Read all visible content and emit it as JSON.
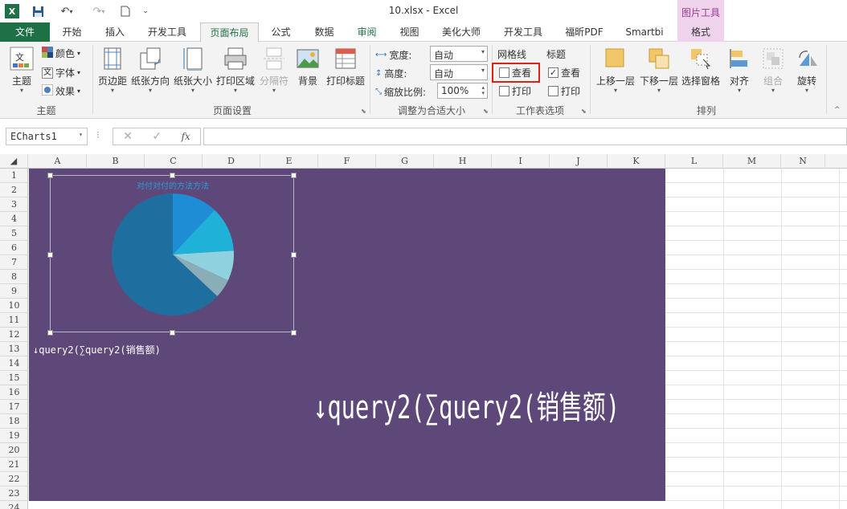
{
  "window": {
    "title": "10.xlsx - Excel",
    "context_group": "图片工具"
  },
  "tabs": [
    {
      "label": "文件"
    },
    {
      "label": "开始"
    },
    {
      "label": "插入"
    },
    {
      "label": "开发工具"
    },
    {
      "label": "页面布局"
    },
    {
      "label": "公式"
    },
    {
      "label": "数据"
    },
    {
      "label": "审阅"
    },
    {
      "label": "视图"
    },
    {
      "label": "美化大师"
    },
    {
      "label": "开发工具"
    },
    {
      "label": "福昕PDF"
    },
    {
      "label": "Smartbi"
    },
    {
      "label": "格式"
    }
  ],
  "ribbon": {
    "theme": {
      "themes": "主题",
      "colors": "颜色",
      "fonts": "字体",
      "effects": "效果",
      "group": "主题"
    },
    "page_setup": {
      "margins": "页边距",
      "orientation": "纸张方向",
      "size": "纸张大小",
      "print_area": "打印区域",
      "breaks": "分隔符",
      "background": "背景",
      "print_titles": "打印标题",
      "group": "页面设置"
    },
    "scale": {
      "width_label": "宽度:",
      "width_value": "自动",
      "height_label": "高度:",
      "height_value": "自动",
      "scale_label": "缩放比例:",
      "scale_value": "100%",
      "group": "调整为合适大小"
    },
    "sheet_options": {
      "gridlines": "网格线",
      "headings": "标题",
      "view": "查看",
      "print": "打印",
      "group": "工作表选项"
    },
    "arrange": {
      "forward": "上移一层",
      "backward": "下移一层",
      "selection_pane": "选择窗格",
      "align": "对齐",
      "group_btn": "组合",
      "rotate": "旋转",
      "group": "排列"
    }
  },
  "formula_bar": {
    "name_box": "ECharts1",
    "fx": "fx"
  },
  "columns": [
    "A",
    "B",
    "C",
    "D",
    "E",
    "F",
    "G",
    "H",
    "I",
    "J",
    "K",
    "L",
    "M",
    "N"
  ],
  "rows": [
    "1",
    "2",
    "3",
    "4",
    "5",
    "6",
    "7",
    "8",
    "9",
    "10",
    "11",
    "12",
    "13",
    "14",
    "15",
    "16",
    "17",
    "18",
    "19",
    "20",
    "21",
    "22",
    "23",
    "24"
  ],
  "sheet": {
    "chart_title": "对付对付的方法方法",
    "cell_label": "↓query2(∑query2(销售额)",
    "big_label": "↓query2(∑query2(销售额)"
  },
  "colors": {
    "sheet_bg": "#5e4879",
    "accent": "#1e7145"
  },
  "chart_data": {
    "type": "pie",
    "title": "对付对付的方法方法",
    "slices": [
      {
        "value": 12,
        "color": "#1f8dd6"
      },
      {
        "value": 12,
        "color": "#1fb1d8"
      },
      {
        "value": 8,
        "color": "#8fd1dd"
      },
      {
        "value": 5,
        "color": "#8aaeb7"
      },
      {
        "value": 63,
        "color": "#1e6f9f"
      }
    ]
  }
}
